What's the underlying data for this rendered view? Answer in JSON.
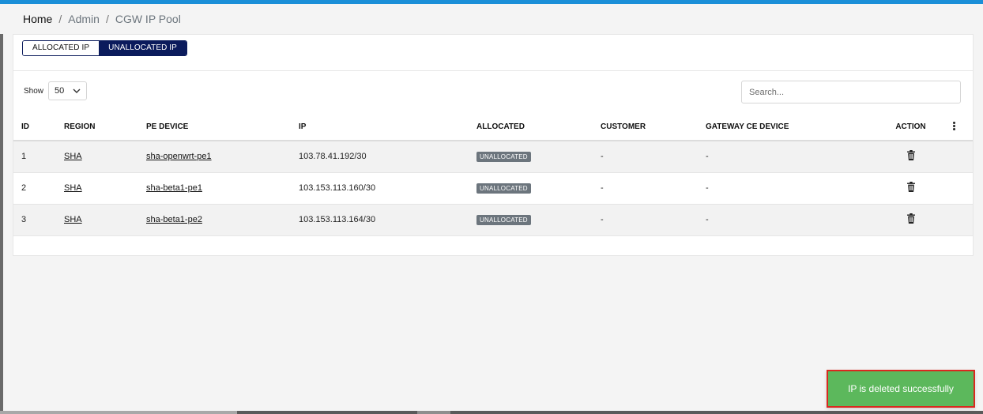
{
  "colors": {
    "topbar": "#1a8fd8",
    "toggle_active": "#0b1b5c",
    "badge": "#6c757d",
    "toast_bg": "#5cb85c",
    "toast_border": "#d9291f"
  },
  "breadcrumb": {
    "home": "Home",
    "admin": "Admin",
    "current": "CGW IP Pool",
    "separator": "/"
  },
  "tabs": {
    "allocated": "ALLOCATED IP",
    "unallocated": "UNALLOCATED IP",
    "active": "unallocated"
  },
  "show": {
    "label": "Show",
    "value": "50"
  },
  "search": {
    "placeholder": "Search..."
  },
  "table": {
    "headers": {
      "id": "ID",
      "region": "REGION",
      "pe_device": "PE DEVICE",
      "ip": "IP",
      "allocated": "ALLOCATED",
      "customer": "CUSTOMER",
      "gateway": "GATEWAY CE DEVICE",
      "action": "ACTION"
    },
    "rows": [
      {
        "id": "1",
        "region": "SHA",
        "pe_device": "sha-openwrt-pe1",
        "ip": "103.78.41.192/30",
        "allocated": "UNALLOCATED",
        "customer": "-",
        "gateway": "-"
      },
      {
        "id": "2",
        "region": "SHA",
        "pe_device": "sha-beta1-pe1",
        "ip": "103.153.113.160/30",
        "allocated": "UNALLOCATED",
        "customer": "-",
        "gateway": "-"
      },
      {
        "id": "3",
        "region": "SHA",
        "pe_device": "sha-beta1-pe2",
        "ip": "103.153.113.164/30",
        "allocated": "UNALLOCATED",
        "customer": "-",
        "gateway": "-"
      }
    ]
  },
  "toast": {
    "message": "IP is deleted successfully"
  }
}
